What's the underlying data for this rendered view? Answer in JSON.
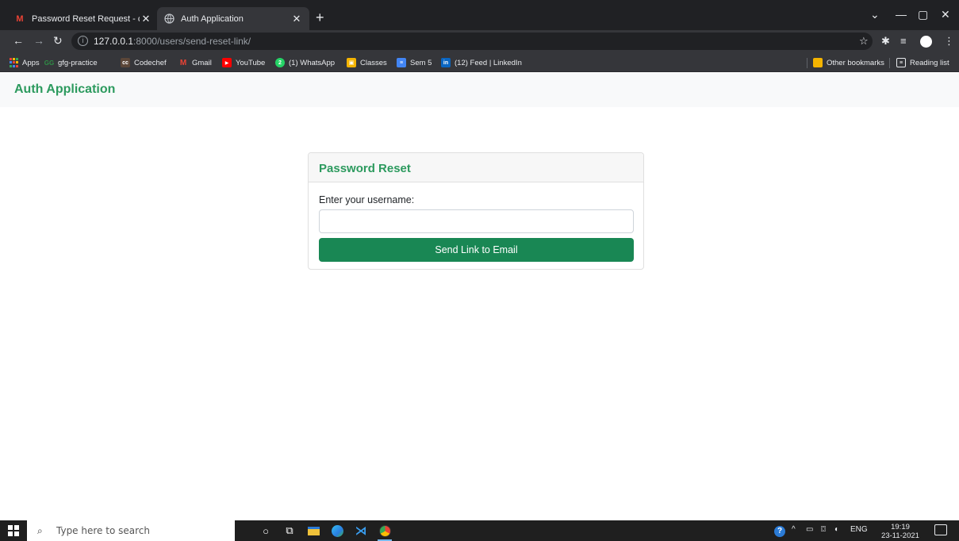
{
  "browser": {
    "tabs": [
      {
        "title": "Password Reset Request - charan",
        "favicon": "gmail-icon"
      },
      {
        "title": "Auth Application",
        "favicon": "globe-icon"
      }
    ],
    "url_host": "127.0.0.1",
    "url_rest": ":8000/users/send-reset-link/",
    "bookmarks": [
      {
        "label": "Apps",
        "icon": "apps-icon",
        "color": "#e8eaed"
      },
      {
        "label": "gfg-practice",
        "icon": "gfg-icon",
        "color": "#2f8d46"
      },
      {
        "label": "Codechef",
        "icon": "codechef-icon",
        "color": "#5b4638"
      },
      {
        "label": "Gmail",
        "icon": "gmail-icon",
        "color": "#ea4335"
      },
      {
        "label": "YouTube",
        "icon": "youtube-icon",
        "color": "#ff0000"
      },
      {
        "label": "(1) WhatsApp",
        "icon": "whatsapp-icon",
        "color": "#25d366"
      },
      {
        "label": "Classes",
        "icon": "classroom-icon",
        "color": "#f4b400"
      },
      {
        "label": "Sem 5",
        "icon": "docs-icon",
        "color": "#4285f4"
      },
      {
        "label": "(12) Feed | LinkedIn",
        "icon": "linkedin-icon",
        "color": "#0a66c2"
      }
    ],
    "other_bookmarks": "Other bookmarks",
    "reading_list": "Reading list"
  },
  "page": {
    "brand": "Auth Application",
    "card_title": "Password Reset",
    "username_label": "Enter your username:",
    "username_value": "",
    "submit_label": "Send Link to Email"
  },
  "taskbar": {
    "search_placeholder": "Type here to search",
    "language": "ENG",
    "time": "19:19",
    "date": "23-11-2021"
  },
  "colors": {
    "accent": "#2c9a5e",
    "button": "#198754"
  }
}
